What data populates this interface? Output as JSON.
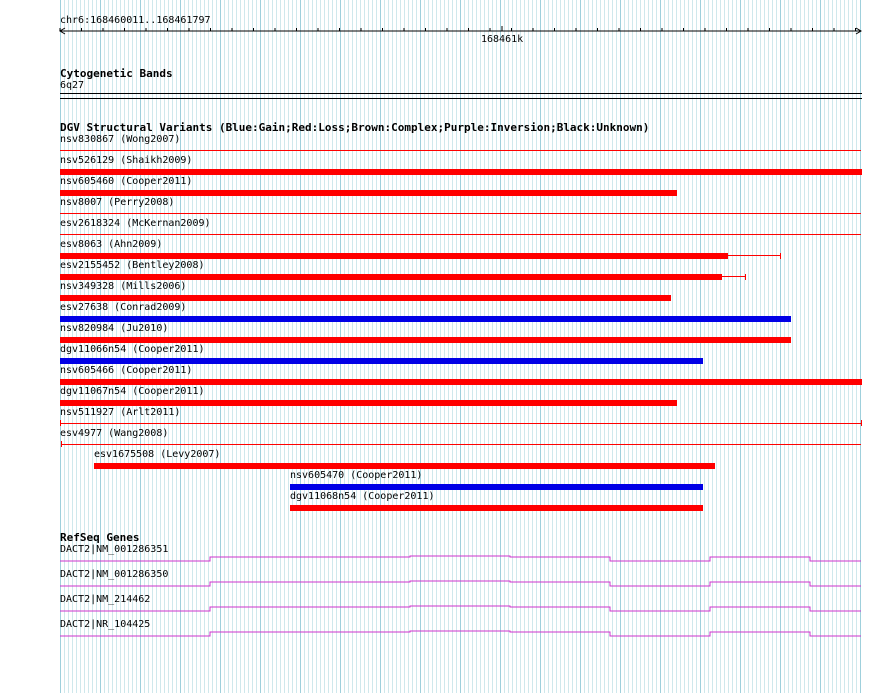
{
  "colors": {
    "gain": "#0000e6",
    "loss": "#ff0000",
    "gene": "#cc33cc",
    "grid_minor": "#cfe8ec",
    "grid_major": "#9fd0dc"
  },
  "ruler": {
    "locus": "chr6:168460011..168461797",
    "mid_tick": "168461k"
  },
  "tracks": {
    "cytoband": {
      "title": "Cytogenetic Bands",
      "band": "6q27"
    },
    "dgv": {
      "title": "DGV Structural Variants (Blue:Gain;Red:Loss;Brown:Complex;Purple:Inversion;Black:Unknown)",
      "variants": [
        {
          "label": "nsv830867 (Wong2007)",
          "type": "loss"
        },
        {
          "label": "nsv526129 (Shaikh2009)",
          "type": "loss"
        },
        {
          "label": "nsv605460 (Cooper2011)",
          "type": "loss"
        },
        {
          "label": "nsv8007 (Perry2008)",
          "type": "loss"
        },
        {
          "label": "esv2618324 (McKernan2009)",
          "type": "loss"
        },
        {
          "label": "esv8063 (Ahn2009)",
          "type": "loss"
        },
        {
          "label": "esv2155452 (Bentley2008)",
          "type": "loss"
        },
        {
          "label": "nsv349328 (Mills2006)",
          "type": "loss"
        },
        {
          "label": "esv27638 (Conrad2009)",
          "type": "gain"
        },
        {
          "label": "nsv820984 (Ju2010)",
          "type": "loss"
        },
        {
          "label": "dgv11066n54 (Cooper2011)",
          "type": "gain"
        },
        {
          "label": "nsv605466 (Cooper2011)",
          "type": "loss"
        },
        {
          "label": "dgv11067n54 (Cooper2011)",
          "type": "loss"
        },
        {
          "label": "nsv511927 (Arlt2011)",
          "type": "loss"
        },
        {
          "label": "esv4977 (Wang2008)",
          "type": "loss"
        },
        {
          "label": "esv1675508 (Levy2007)",
          "type": "loss"
        },
        {
          "label": "nsv605470 (Cooper2011)",
          "type": "gain"
        },
        {
          "label": "dgv11068n54 (Cooper2011)",
          "type": "loss"
        }
      ]
    },
    "refseq": {
      "title": "RefSeq Genes",
      "genes": [
        {
          "label": "DACT2|NM_001286351"
        },
        {
          "label": "DACT2|NM_001286350"
        },
        {
          "label": "DACT2|NM_214462"
        },
        {
          "label": "DACT2|NR_104425"
        }
      ]
    }
  }
}
